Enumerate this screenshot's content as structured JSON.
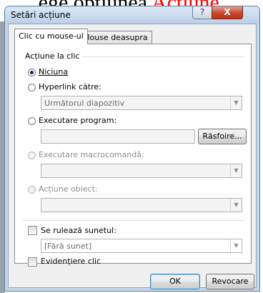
{
  "background": {
    "prefix": "ege opțiunea ",
    "accent_word": "Acțiune,",
    "accent_color": "#ff0000"
  },
  "window": {
    "title": "Setări acțiune",
    "help_glyph": "?",
    "close_glyph": "X"
  },
  "tabs": [
    {
      "label": "Clic cu mouse-ul",
      "active": true
    },
    {
      "label": "Mouse deasupra",
      "active": false
    }
  ],
  "action_group": {
    "label": "Acțiune la clic",
    "options": [
      {
        "label": "Niciuna",
        "selected": true,
        "enabled": true
      },
      {
        "label": "Hyperlink către:",
        "selected": false,
        "enabled": true
      },
      {
        "label": "Executare program:",
        "selected": false,
        "enabled": true
      },
      {
        "label": "Executare macrocomandă:",
        "selected": false,
        "enabled": false
      },
      {
        "label": "Acțiune obiect:",
        "selected": false,
        "enabled": false
      }
    ],
    "hyperlink_value": "Următorul diapozitiv",
    "browse_label": "Răsfoire..."
  },
  "sound": {
    "label": "Se rulează sunetul:",
    "value": "[Fără sunet]",
    "checked": false
  },
  "highlight": {
    "label": "Evidențiere clic",
    "checked": false
  },
  "buttons": {
    "ok": "OK",
    "cancel": "Revocare"
  }
}
